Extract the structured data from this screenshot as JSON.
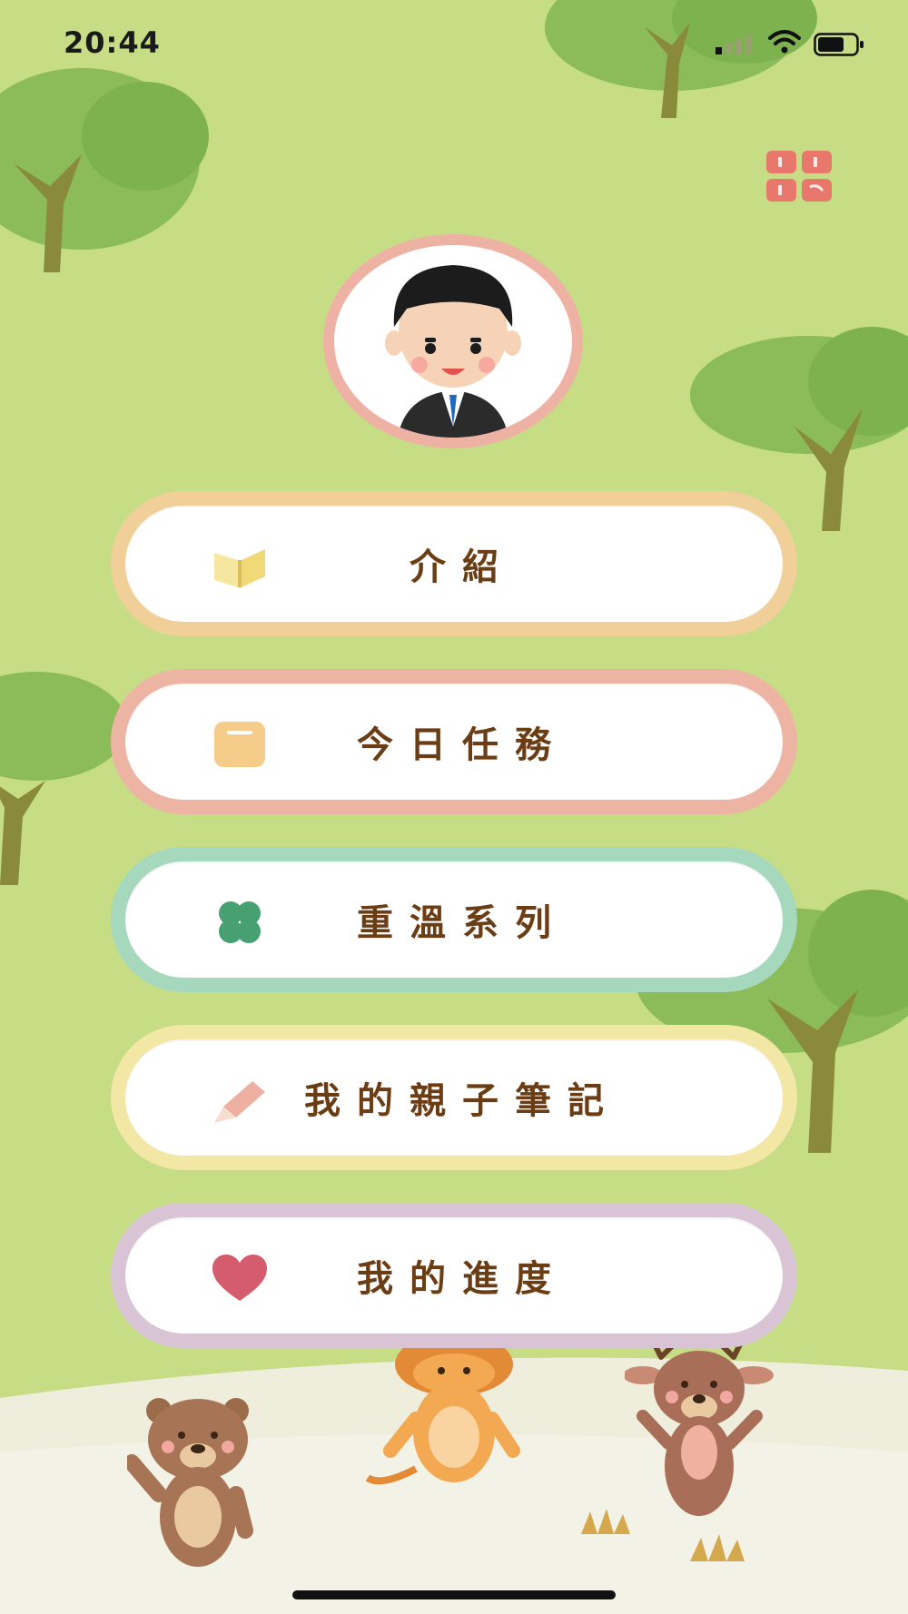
{
  "status_bar": {
    "time": "20:44"
  },
  "menu": [
    {
      "id": "intro",
      "label": "介紹",
      "ring_color": "#f1cf99",
      "icon": "book-icon"
    },
    {
      "id": "tasks",
      "label": "今日任務",
      "ring_color": "#eeb4a3",
      "icon": "notepad-icon"
    },
    {
      "id": "review",
      "label": "重溫系列",
      "ring_color": "#a6d8bd",
      "icon": "clover-icon"
    },
    {
      "id": "notes",
      "label": "我的親子筆記",
      "ring_color": "#f3e7a6",
      "icon": "pencil-icon"
    },
    {
      "id": "progress",
      "label": "我的進度",
      "ring_color": "#d9c4d6",
      "icon": "heart-icon"
    }
  ],
  "colors": {
    "background": "#c6dd86",
    "text": "#6b3d14",
    "accent": "#e9786c"
  }
}
